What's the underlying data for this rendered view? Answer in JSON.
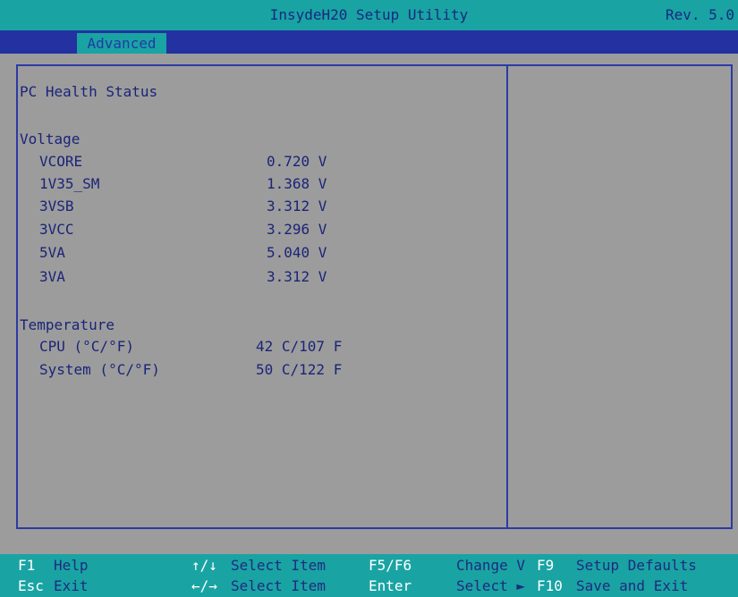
{
  "header": {
    "title": "InsydeH20 Setup Utility",
    "revision": "Rev. 5.0"
  },
  "tabs": [
    {
      "label": "Advanced"
    }
  ],
  "main": {
    "heading": "PC Health Status",
    "voltage": {
      "label": "Voltage",
      "items": [
        {
          "name": "VCORE",
          "value": "0.720 V"
        },
        {
          "name": "1V35_SM",
          "value": "1.368 V"
        },
        {
          "name": "3VSB",
          "value": "3.312 V"
        },
        {
          "name": "3VCC",
          "value": "3.296 V"
        },
        {
          "name": "5VA",
          "value": "5.040 V"
        },
        {
          "name": "3VA",
          "value": "3.312 V"
        }
      ]
    },
    "temperature": {
      "label": "Temperature",
      "items": [
        {
          "name": "CPU (°C/°F)",
          "value": "42 C/107 F"
        },
        {
          "name": "System (°C/°F)",
          "value": "50 C/122 F"
        }
      ]
    }
  },
  "footer": {
    "f1_key": "F1",
    "f1_desc": "Help",
    "esc_key": "Esc",
    "esc_desc": "Exit",
    "updown_key": "↑/↓",
    "updown_desc": "Select Item",
    "leftright_key": "←/→",
    "leftright_desc": "Select Item",
    "f5f6_key": "F5/F6",
    "f5f6_desc": "Change Values",
    "change_word": "Change V",
    "enter_key": "Enter",
    "enter_desc": "Select ► SubMenu",
    "select_word": "Select ►",
    "f9_key": "F9",
    "f9_desc": "Setup Defaults",
    "f10_key": "F10",
    "f10_desc": "Save and Exit"
  },
  "colors": {
    "background": "#9c9c9c",
    "accent": "#1aa3a3",
    "border": "#2c3aa4",
    "text": "#1b2478"
  }
}
